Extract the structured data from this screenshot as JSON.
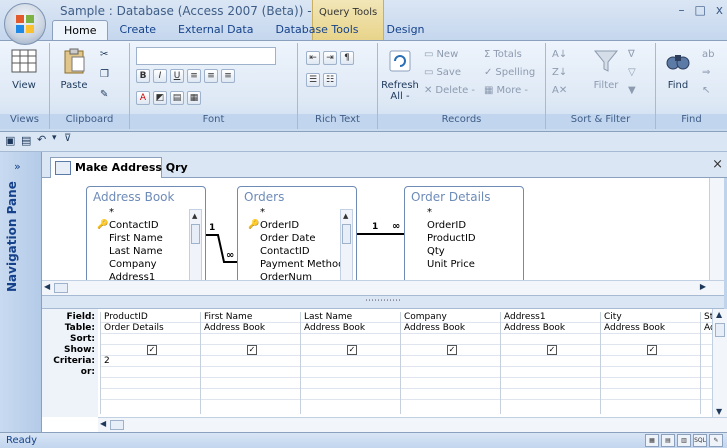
{
  "window": {
    "title": "Sample : Database (Access 2007 (Beta)) - Micr...",
    "contextual_tab_group": "Query Tools",
    "controls": [
      "–",
      "□",
      "x"
    ]
  },
  "ribbon_tabs": [
    {
      "label": "Home",
      "active": true
    },
    {
      "label": "Create",
      "active": false
    },
    {
      "label": "External Data",
      "active": false
    },
    {
      "label": "Database Tools",
      "active": false
    },
    {
      "label": "Design",
      "active": false
    }
  ],
  "ribbon": {
    "views": {
      "label": "Views",
      "view_button": "View"
    },
    "clipboard": {
      "label": "Clipboard",
      "paste_button": "Paste"
    },
    "font": {
      "label": "Font"
    },
    "rich_text": {
      "label": "Rich Text"
    },
    "records": {
      "label": "Records",
      "refresh_button": "Refresh All -",
      "new": "New",
      "save": "Save",
      "delete": "Delete -",
      "totals": "Totals",
      "spelling": "Spelling",
      "more": "More -"
    },
    "sort_filter": {
      "label": "Sort & Filter",
      "filter_button": "Filter"
    },
    "find": {
      "label": "Find",
      "find_button": "Find"
    }
  },
  "navigation_pane": {
    "label": "Navigation Pane",
    "toggle": "»"
  },
  "document": {
    "tab_title": "Make Address Qry",
    "close": "×"
  },
  "tables": [
    {
      "name": "Address Book",
      "fields": [
        {
          "name": "*",
          "key": false
        },
        {
          "name": "ContactID",
          "key": true
        },
        {
          "name": "First Name",
          "key": false
        },
        {
          "name": "Last Name",
          "key": false
        },
        {
          "name": "Company",
          "key": false
        },
        {
          "name": "Address1",
          "key": false
        }
      ]
    },
    {
      "name": "Orders",
      "fields": [
        {
          "name": "*",
          "key": false
        },
        {
          "name": "OrderID",
          "key": true
        },
        {
          "name": "Order Date",
          "key": false
        },
        {
          "name": "ContactID",
          "key": false
        },
        {
          "name": "Payment Method",
          "key": false
        },
        {
          "name": "OrderNum",
          "key": false
        }
      ]
    },
    {
      "name": "Order Details",
      "fields": [
        {
          "name": "*",
          "key": false
        },
        {
          "name": "OrderID",
          "key": false
        },
        {
          "name": "ProductID",
          "key": false
        },
        {
          "name": "Qty",
          "key": false
        },
        {
          "name": "Unit Price",
          "key": false
        }
      ]
    }
  ],
  "relationships": [
    {
      "from_label": "1",
      "to_label": "∞"
    },
    {
      "from_label": "1",
      "to_label": "∞"
    }
  ],
  "qbe": {
    "row_labels": [
      "Field:",
      "Table:",
      "Sort:",
      "Show:",
      "Criteria:",
      "or:"
    ],
    "columns": [
      {
        "field": "ProductID",
        "table": "Order Details",
        "show": true,
        "criteria": "2"
      },
      {
        "field": "First Name",
        "table": "Address Book",
        "show": true,
        "criteria": ""
      },
      {
        "field": "Last Name",
        "table": "Address Book",
        "show": true,
        "criteria": ""
      },
      {
        "field": "Company",
        "table": "Address Book",
        "show": true,
        "criteria": ""
      },
      {
        "field": "Address1",
        "table": "Address Book",
        "show": true,
        "criteria": ""
      },
      {
        "field": "City",
        "table": "Address Book",
        "show": true,
        "criteria": ""
      },
      {
        "field": "Sta",
        "table": "Add",
        "show": false,
        "criteria": ""
      }
    ]
  },
  "status": {
    "text": "Ready",
    "sql_label": "SQL"
  }
}
